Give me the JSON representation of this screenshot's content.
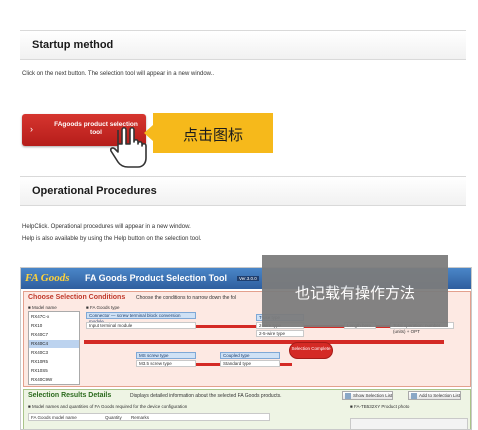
{
  "startup": {
    "heading": "Startup method",
    "instruction": "Click on the next button. The selection tool will appear in a new window..",
    "button_line1": "FAgoods product selection",
    "button_line2": "tool",
    "button_chevron": "›",
    "callout": "点击图标"
  },
  "operational": {
    "heading": "Operational Procedures",
    "line1": "HelpClick. Operational procedures will appear in a new window.",
    "line2": "Help is also available by using the Help button on the selection tool.",
    "callout": "也记载有操作方法"
  },
  "tool": {
    "brand": "FA Goods",
    "title": "FA Goods Product Selection Tool",
    "version": "Ver.3.0.0",
    "choose": {
      "heading": "Choose Selection Conditions",
      "hint": "Choose the conditions to narrow down the fol",
      "model_name_label": "■ Model name",
      "models": [
        "RX47C-x",
        "RX10",
        "RX40C7",
        "RX40C4",
        "RX40C3",
        "RX10R5",
        "RX10S5",
        "RX40C9W"
      ],
      "fa_goods_type_label": "■ FA Goods type",
      "type_row1": "Connector — screw terminal block conversion module",
      "type_row2": "Input terminal module",
      "wire_label": "T-use type",
      "wire_opt1": "2-wire type",
      "wire_opt2": "2-5-wire type",
      "range_label": "Length here",
      "range_hint": "Total operation: number (units) + OPT",
      "ms_label": "MS screw type",
      "ms_opt": "M3.5 screw type",
      "coupled_label": "Coupled type",
      "coupled_opt": "Standard type",
      "selection_button": "Selection Complete"
    },
    "results": {
      "heading": "Selection Results Details",
      "hint": "Displays detailed information about the selected FA Goods products.",
      "show_btn": "Show Selection List",
      "add_btn": "Add to Selection List",
      "note": "■ Model names and quantities of FA Goods required for the device configuration",
      "product_photo": "■ FA-TB532XY Product photo",
      "col_model": "FA Goods model name",
      "col_qty": "Quantity",
      "col_remarks": "Remarks"
    }
  },
  "colors": {
    "button_red": "#c8281f",
    "callout_yellow": "#f6b91b",
    "callout_gray": "#7c7c7c",
    "tool_blue": "#2f5e9e"
  }
}
